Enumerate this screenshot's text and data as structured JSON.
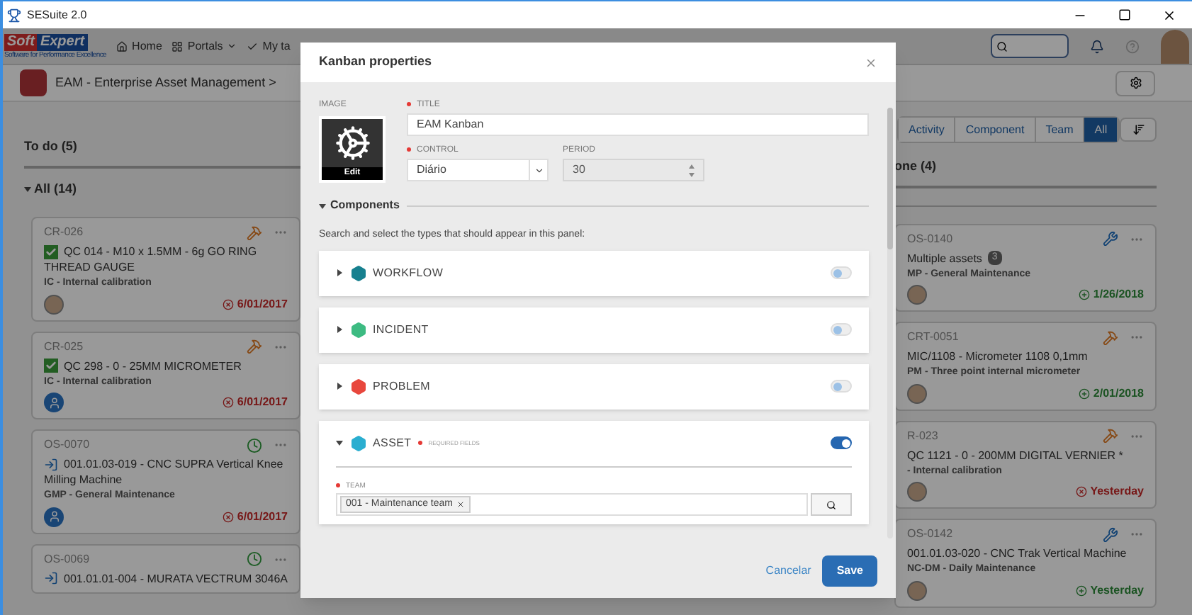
{
  "window": {
    "title": "SESuite 2.0"
  },
  "nav": {
    "logo": {
      "brand_left": "Soft",
      "brand_right": "Expert",
      "tagline": "Software for Performance Excellence"
    },
    "items": [
      {
        "label": "Home",
        "menu": false
      },
      {
        "label": "Portals",
        "menu": true
      },
      {
        "label": "My ta",
        "menu": false
      }
    ]
  },
  "header": {
    "breadcrumb": "EAM - Enterprise Asset Management >"
  },
  "todo": {
    "title": "To do (5)",
    "group": "All (14)",
    "cards": [
      {
        "kind": "calibration",
        "code": "CR-026",
        "title": "QC 014 - M10 x 1.5MM - 6g GO RING THREAD GAUGE",
        "subtitle": "IC - Internal calibration",
        "photo": true,
        "date": "6/01/2017",
        "overdue": true
      },
      {
        "kind": "calibration",
        "code": "CR-025",
        "title": "QC 298 - 0 - 25MM MICROMETER",
        "subtitle": "IC - Internal calibration",
        "photo": false,
        "date": "6/01/2017",
        "overdue": true
      },
      {
        "kind": "scheduled",
        "code": "OS-0070",
        "title": "001.01.03-019 - CNC SUPRA Vertical Knee Milling Machine",
        "subtitle": "GMP - General Maintenance",
        "photo": false,
        "date": "6/01/2017",
        "overdue": true
      },
      {
        "kind": "scheduled",
        "code": "OS-0069",
        "title": "001.01.01-004 - MURATA VECTRUM 3046A"
      }
    ]
  },
  "done": {
    "title": "one (4)",
    "tabs": [
      {
        "label": "Activity",
        "selected": false
      },
      {
        "label": "Component",
        "selected": false
      },
      {
        "label": "Team",
        "selected": false
      },
      {
        "label": "All",
        "selected": true
      }
    ],
    "cards": [
      {
        "kind": "repair",
        "code": "OS-0140",
        "title": "Multiple assets",
        "count": "3",
        "subtitle": "MP - General Maintenance",
        "photo": true,
        "date": "1/26/2018",
        "overdue": false
      },
      {
        "kind": "calibration",
        "code": "CRT-0051",
        "title": "MIC/1108 - Micrometer 1108 0,1mm",
        "subtitle": "PM - Three point internal micrometer",
        "photo": true,
        "date": "2/01/2018",
        "overdue": false
      },
      {
        "kind": "calibration",
        "code": "R-023",
        "title": "QC 1121 - 0 - 200MM DIGITAL VERNIER *",
        "subtitle": "- Internal calibration",
        "photo": true,
        "date": "Yesterday",
        "overdue": true
      },
      {
        "kind": "repair",
        "code": "OS-0142",
        "title": "001.01.03-020 - CNC Trak Vertical Machine",
        "subtitle": "NC-DM - Daily Maintenance",
        "photo": true,
        "date": "Yesterday",
        "overdue": false
      }
    ]
  },
  "modal": {
    "title": "Kanban properties",
    "image": {
      "label": "IMAGE",
      "action": "Edit"
    },
    "fields": {
      "title": {
        "label": "TITLE",
        "required": true,
        "value": "EAM Kanban"
      },
      "control": {
        "label": "CONTROL",
        "required": true,
        "value": "Diário"
      },
      "period": {
        "label": "PERIOD",
        "required": false,
        "value": "30"
      }
    },
    "section": {
      "title": "Components",
      "expanded": true
    },
    "hint": "Search and select the types that should appear in this panel:",
    "components": [
      {
        "name": "WORKFLOW",
        "color": "#17808f",
        "on": false,
        "expanded": false
      },
      {
        "name": "INCIDENT",
        "color": "#3dbb82",
        "on": false,
        "expanded": false
      },
      {
        "name": "PROBLEM",
        "color": "#e8473d",
        "on": false,
        "expanded": false
      },
      {
        "name": "ASSET",
        "color": "#2aaed0",
        "on": true,
        "expanded": true,
        "required_note": "REQUIRED FIELDS",
        "field": {
          "label": "TEAM",
          "required": true,
          "tags": [
            "001 - Maintenance team"
          ]
        }
      }
    ],
    "buttons": {
      "cancel": "Cancelar",
      "save": "Save"
    }
  }
}
